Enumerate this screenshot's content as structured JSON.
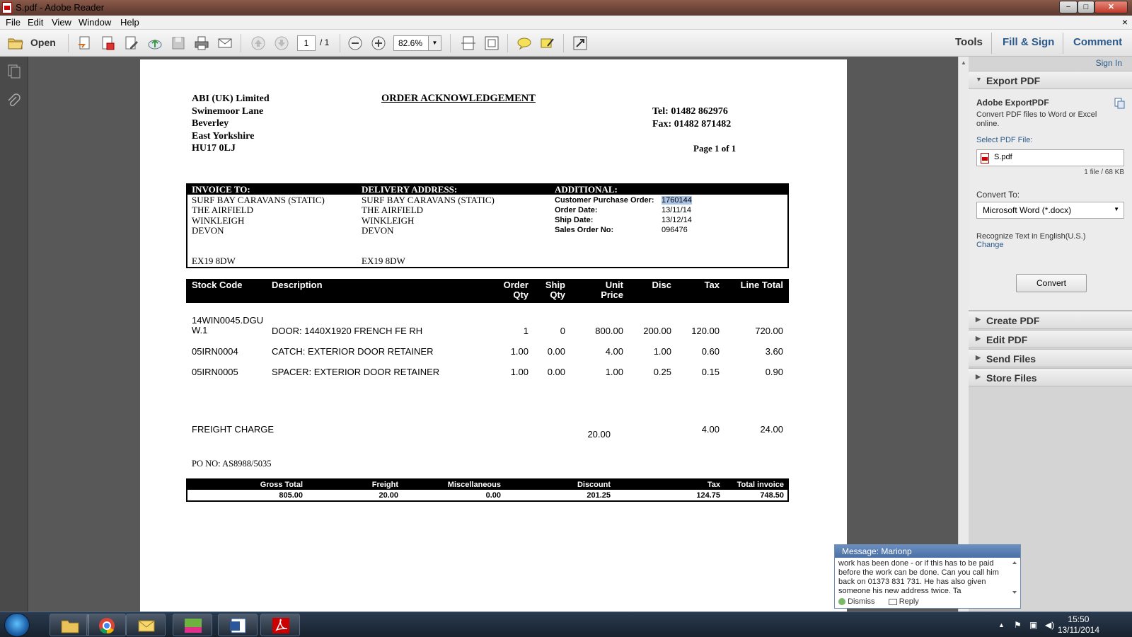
{
  "window": {
    "title": "S.pdf - Adobe Reader",
    "minimize": "−",
    "maximize": "□",
    "close": "✕"
  },
  "menu": {
    "items": [
      "File",
      "Edit",
      "View",
      "Window",
      "Help"
    ],
    "close": "×"
  },
  "toolbar": {
    "open_label": "Open",
    "page_current": "1",
    "page_total": "/ 1",
    "zoom": "82.6%",
    "tabs": [
      "Tools",
      "Fill & Sign",
      "Comment"
    ]
  },
  "document": {
    "company": [
      "ABI (UK) Limited",
      "Swinemoor Lane",
      "Beverley",
      "East Yorkshire",
      "HU17 0LJ"
    ],
    "title": "ORDER ACKNOWLEDGEMENT",
    "tel": "Tel:   01482 862976",
    "fax": "Fax: 01482 871482",
    "page_of": "Page 1 of 1",
    "invoice_to": {
      "heading": "INVOICE TO:",
      "lines": [
        "SURF BAY CARAVANS (STATIC)",
        "THE AIRFIELD",
        "WINKLEIGH",
        "DEVON"
      ],
      "postcode": "EX19 8DW"
    },
    "delivery_address": {
      "heading": "DELIVERY ADDRESS:",
      "lines": [
        "SURF BAY CARAVANS (STATIC)",
        "THE AIRFIELD",
        "WINKLEIGH",
        "DEVON"
      ],
      "postcode": "EX19 8DW"
    },
    "additional": {
      "heading": "ADDITIONAL:",
      "labels": [
        "Customer Purchase Order:",
        "Order Date:",
        "Ship Date:",
        "Sales Order No:"
      ],
      "values": [
        "1760144",
        "13/11/14",
        "13/12/14",
        "096476"
      ]
    },
    "columns": {
      "stock_code": "Stock Code",
      "description": "Description",
      "order_qty": [
        "Order",
        "Qty"
      ],
      "ship_qty": [
        "Ship",
        "Qty"
      ],
      "unit_price": [
        "Unit",
        "Price"
      ],
      "disc": "Disc",
      "tax": "Tax",
      "line_total": "Line Total"
    },
    "items": [
      {
        "code": [
          "14WIN0045.DGU",
          "W.1"
        ],
        "description": "DOOR: 1440X1920 FRENCH FE RH",
        "order_qty": "1",
        "ship_qty": "0",
        "unit_price": "800.00",
        "disc": "200.00",
        "tax": "120.00",
        "line_total": "720.00"
      },
      {
        "code": [
          "05IRN0004"
        ],
        "description": "CATCH: EXTERIOR DOOR RETAINER",
        "order_qty": "1.00",
        "ship_qty": "0.00",
        "unit_price": "4.00",
        "disc": "1.00",
        "tax": "0.60",
        "line_total": "3.60"
      },
      {
        "code": [
          "05IRN0005"
        ],
        "description": "SPACER: EXTERIOR DOOR RETAINER",
        "order_qty": "1.00",
        "ship_qty": "0.00",
        "unit_price": "1.00",
        "disc": "0.25",
        "tax": "0.15",
        "line_total": "0.90"
      }
    ],
    "freight": {
      "label": "FREIGHT CHARGE",
      "price": "20.00",
      "tax": "4.00",
      "total": "24.00"
    },
    "po_no": "PO NO: AS8988/5035",
    "totals": {
      "labels": [
        "Gross Total",
        "Freight",
        "Miscellaneous",
        "Discount",
        "Tax",
        "Total invoice"
      ],
      "values": [
        "805.00",
        "20.00",
        "0.00",
        "201.25",
        "124.75",
        "748.50"
      ]
    }
  },
  "right_panel": {
    "sign_in": "Sign In",
    "export_header": "Export PDF",
    "service_title": "Adobe ExportPDF",
    "service_desc": "Convert PDF files to Word or Excel online.",
    "select_label": "Select PDF File:",
    "file_name": "S.pdf",
    "file_info": "1 file / 68 KB",
    "convert_to_label": "Convert To:",
    "convert_to_value": "Microsoft Word (*.docx)",
    "recognize_text": "Recognize Text in English(U.S.)",
    "change_link": "Change",
    "convert_button": "Convert",
    "sections": [
      "Create PDF",
      "Edit PDF",
      "Send Files",
      "Store Files"
    ]
  },
  "notification": {
    "title": "Message: Marionp",
    "body": "work has been done - or if this has to be paid before the work can be done. Can you call him back on 01373 831 731. He has also given someone his new address twice. Ta",
    "dismiss": "Dismiss",
    "reply": "Reply"
  },
  "taskbar": {
    "time": "15:50",
    "date": "13/11/2014"
  }
}
